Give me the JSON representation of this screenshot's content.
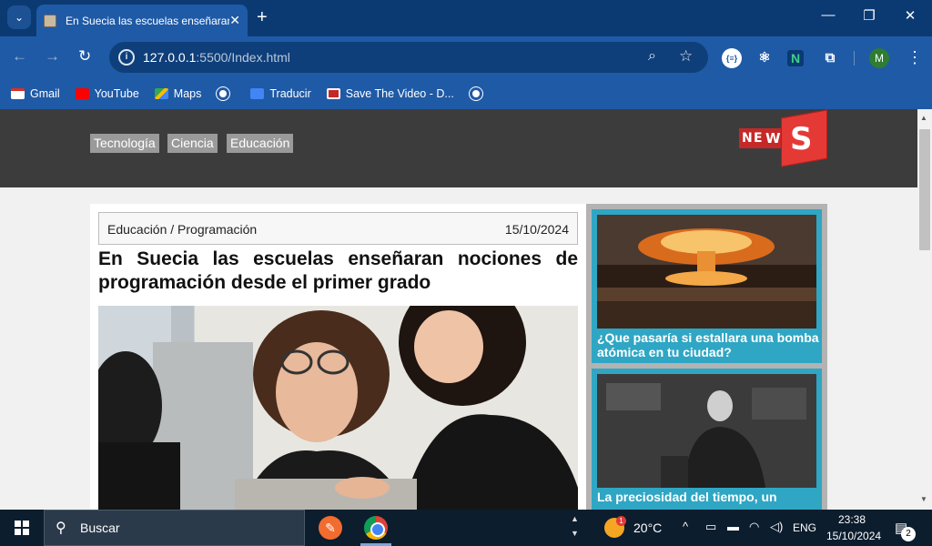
{
  "browser": {
    "tab_title": "En Suecia las escuelas enseñaran",
    "url_host": "127.0.0.1",
    "url_rest": ":5500/Index.html",
    "profile_initial": "M",
    "ext_json_label": "{≡}",
    "ext_n_label": "N",
    "bookmarks": [
      {
        "label": "Gmail",
        "icon": "gmail-icon"
      },
      {
        "label": "YouTube",
        "icon": "youtube-icon"
      },
      {
        "label": "Maps",
        "icon": "maps-icon"
      },
      {
        "label": "",
        "icon": "globe-icon"
      },
      {
        "label": "Traducir",
        "icon": "translate-icon"
      },
      {
        "label": "Save The Video - D...",
        "icon": "save-the-video-icon"
      },
      {
        "label": "",
        "icon": "globe-icon"
      }
    ]
  },
  "site": {
    "nav": [
      "Tecnología",
      "Ciencia",
      "Educación"
    ],
    "logo": {
      "letters": [
        "N",
        "E",
        "W",
        "S"
      ],
      "color": "#e53935"
    },
    "article": {
      "category": "Educación / Programación",
      "date": "15/10/2024",
      "title": "En Suecia las escuelas enseñaran nociones de programación desde el primer grado"
    },
    "sidebar": [
      {
        "title": "¿Que pasaría si estallara una bomba atómica en tu ciudad?"
      },
      {
        "title": "La preciosidad del tiempo, un"
      }
    ]
  },
  "taskbar": {
    "search_placeholder": "Buscar",
    "weather_temp": "20°C",
    "weather_badge": "1",
    "language": "ENG",
    "time": "23:38",
    "date": "15/10/2024",
    "notifications": "2"
  },
  "colors": {
    "browser_frame": "#1f5aa6",
    "site_header": "#3c3c3c",
    "card_bg": "#2fa6c4",
    "taskbar": "#0c1d2e"
  }
}
